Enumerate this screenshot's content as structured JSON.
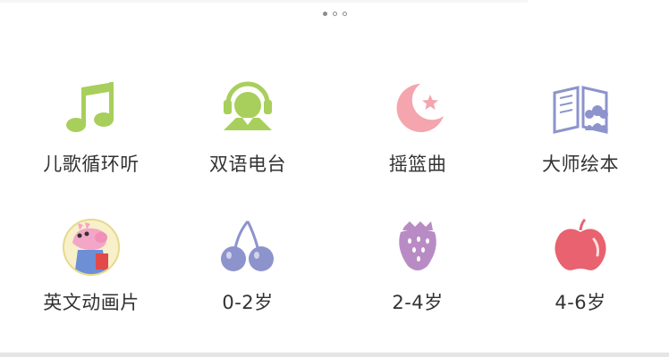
{
  "pager": {
    "page_count": 3,
    "active_index": 0
  },
  "grid": {
    "items": [
      {
        "label": "儿歌循环听",
        "icon": "music-note-icon",
        "color": "#a8cf5b"
      },
      {
        "label": "双语电台",
        "icon": "headphones-user-icon",
        "color": "#a8cf5b"
      },
      {
        "label": "摇篮曲",
        "icon": "moon-star-icon",
        "color": "#f4a5ad"
      },
      {
        "label": "大师绘本",
        "icon": "open-book-icon",
        "color": "#8d93cc"
      },
      {
        "label": "英文动画片",
        "icon": "peppa-pig-avatar-icon",
        "color": "#f0a8c8"
      },
      {
        "label": "0-2岁",
        "icon": "cherry-icon",
        "color": "#8d93cc"
      },
      {
        "label": "2-4岁",
        "icon": "strawberry-icon",
        "color": "#b98bc4"
      },
      {
        "label": "4-6岁",
        "icon": "apple-icon",
        "color": "#e8626f"
      }
    ]
  }
}
